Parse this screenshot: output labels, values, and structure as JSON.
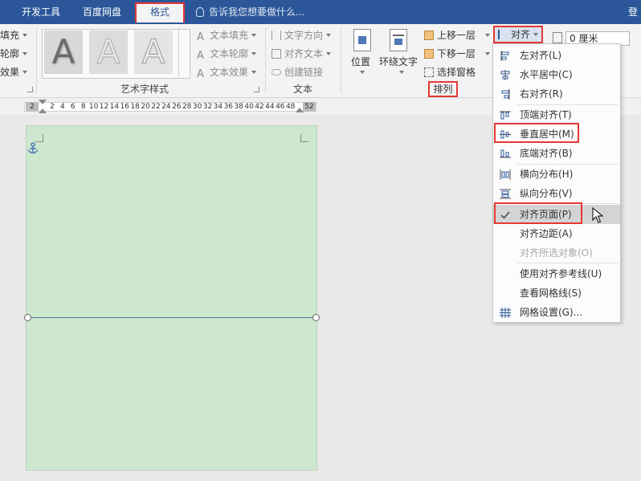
{
  "tabs": {
    "developer": "开发工具",
    "baidu": "百度网盘",
    "format": "格式",
    "tell_me": "告诉我您想要做什么...",
    "login": "登"
  },
  "ribbon": {
    "shape_fill": "填充",
    "shape_outline": "轮廓",
    "shape_effects": "效果",
    "wordart_group": "艺术字样式",
    "wordart_letter": "A",
    "text_fill": "文本填充",
    "text_outline": "文本轮廓",
    "text_effects": "文本效果",
    "text_direction": "文字方向",
    "align_text": "对齐文本",
    "create_link": "创建链接",
    "text_group": "文本",
    "position": "位置",
    "wrap_text": "环绕文字",
    "bring_forward": "上移一层",
    "send_backward": "下移一层",
    "selection_pane": "选择窗格",
    "arrange_group": "排列",
    "align": "对齐",
    "size_value": "0 厘米"
  },
  "ruler": {
    "left_marker": "2",
    "ticks": [
      "2",
      "4",
      "6",
      "8",
      "10",
      "12",
      "14",
      "16",
      "18",
      "20",
      "22",
      "24",
      "26",
      "28",
      "30",
      "32",
      "34",
      "36",
      "38",
      "40",
      "42",
      "44",
      "46",
      "48"
    ],
    "right_marker": "52"
  },
  "menu": {
    "items": [
      {
        "label": "左对齐(L)",
        "icon": "align-left-icon"
      },
      {
        "label": "水平居中(C)",
        "icon": "align-center-icon"
      },
      {
        "label": "右对齐(R)",
        "icon": "align-right-icon"
      },
      {
        "label": "顶端对齐(T)",
        "icon": "align-top-icon"
      },
      {
        "label": "垂直居中(M)",
        "icon": "align-middle-icon"
      },
      {
        "label": "底端对齐(B)",
        "icon": "align-bottom-icon"
      },
      {
        "label": "横向分布(H)",
        "icon": "distribute-horizontal-icon"
      },
      {
        "label": "纵向分布(V)",
        "icon": "distribute-vertical-icon"
      },
      {
        "label": "对齐页面(P)",
        "icon": "checkmark-icon"
      },
      {
        "label": "对齐边距(A)"
      },
      {
        "label": "对齐所选对象(O)"
      },
      {
        "label": "使用对齐参考线(U)"
      },
      {
        "label": "查看网格线(S)"
      },
      {
        "label": "网格设置(G)...",
        "icon": "grid-icon"
      }
    ]
  },
  "colors": {
    "title_bar": "#2b579a",
    "highlight": "#e53935",
    "page": "#cde8cf"
  }
}
